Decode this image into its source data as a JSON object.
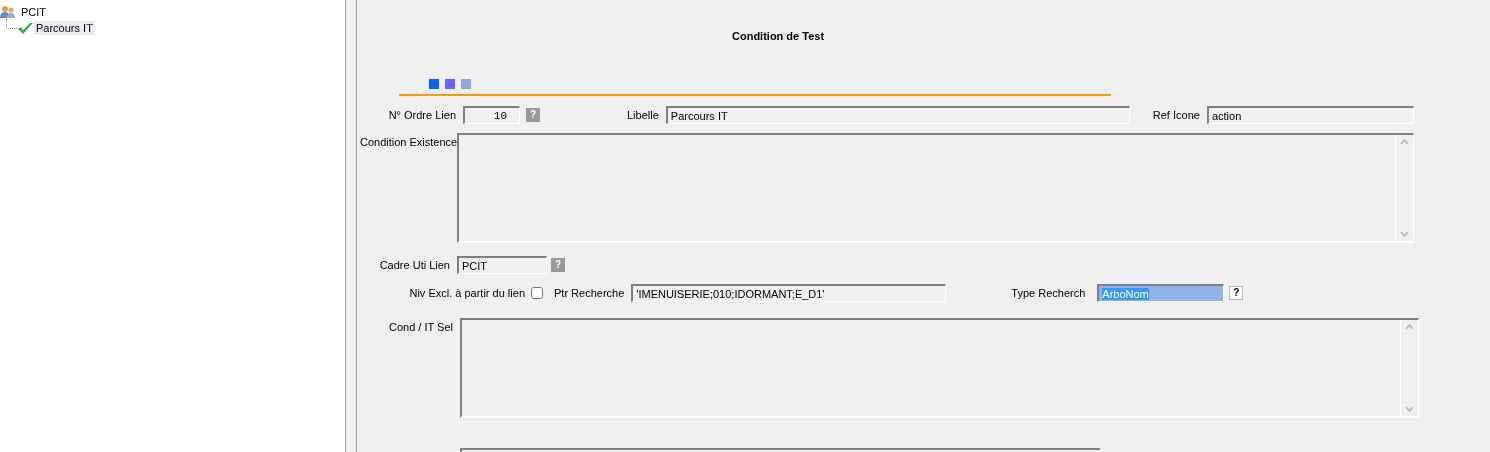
{
  "tree": {
    "root": {
      "label": "PCIT",
      "children": [
        {
          "label": "Parcours IT",
          "selected": true
        }
      ]
    }
  },
  "form": {
    "title": "Condition de Test",
    "markers": [
      {
        "color": "#0066ff"
      },
      {
        "color": "#6666ff"
      },
      {
        "color": "#88aadd"
      }
    ],
    "ordre": {
      "label": "N° Ordre Lien",
      "value": "10",
      "help": {
        "label": "?",
        "disabled": true
      }
    },
    "libelle": {
      "label": "Libelle",
      "value": "Parcours IT"
    },
    "ref_icone": {
      "label": "Ref Icone",
      "value": "action"
    },
    "condition_existence": {
      "label": "Condition Existence"
    },
    "cadre": {
      "label": "Cadre Uti Lien",
      "value": "PCIT",
      "help": {
        "label": "?",
        "disabled": true
      }
    },
    "niv_excl": {
      "label": "Niv Excl. à partir du lien",
      "checked": false
    },
    "ptr_recherche": {
      "label": "Ptr Recherche",
      "value": "'IMENUISERIE;010;IDORMANT;E_D1'"
    },
    "type_recherch": {
      "label": "Type Recherch",
      "value": "ArboNom",
      "selected": true,
      "help": {
        "label": "?",
        "disabled": false
      }
    },
    "cond_it_sel": {
      "label": "Cond / IT Sel"
    }
  }
}
